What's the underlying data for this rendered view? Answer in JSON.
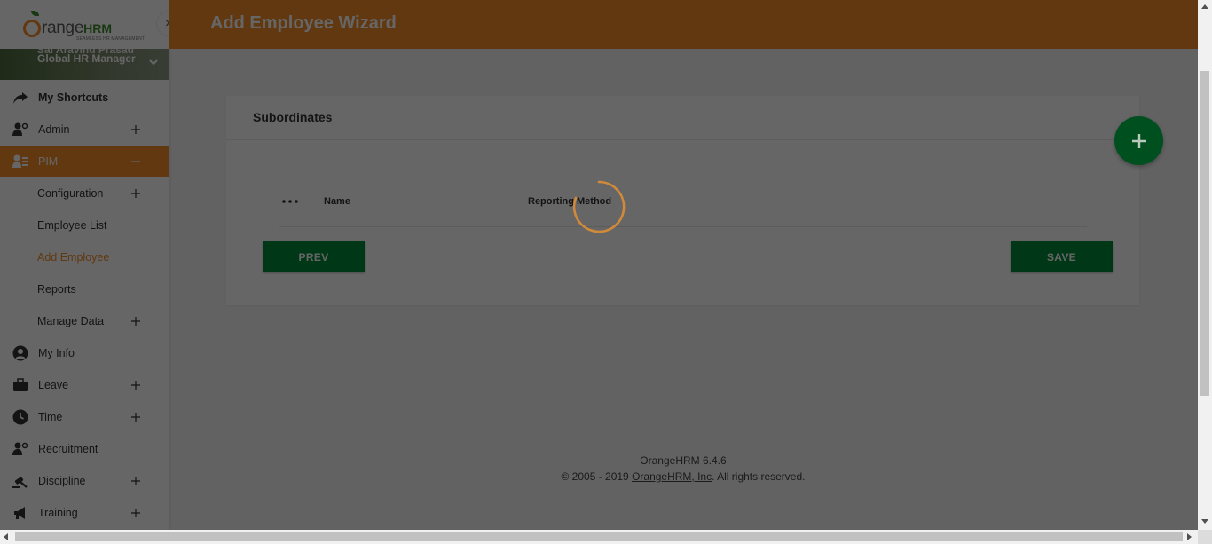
{
  "header": {
    "title": "Add Employee Wizard"
  },
  "logo": {
    "text": "range",
    "hrm": "HRM",
    "tagline": "SEAMLESS HR MANAGEMENT"
  },
  "user": {
    "name_partial": "Sai Aravind Prasad",
    "role": "Global HR Manager"
  },
  "sidebar": {
    "items": [
      {
        "label": "My Shortcuts",
        "icon": "share-arrow-icon"
      },
      {
        "label": "Admin",
        "icon": "user-gear-icon",
        "expandable": true
      },
      {
        "label": "PIM",
        "icon": "id-card-icon",
        "expanded": true,
        "active": true
      },
      {
        "label": "Configuration",
        "sub": true,
        "expandable": true
      },
      {
        "label": "Employee List",
        "sub": true
      },
      {
        "label": "Add Employee",
        "sub": true,
        "current": true
      },
      {
        "label": "Reports",
        "sub": true
      },
      {
        "label": "Manage Data",
        "sub": true,
        "expandable": true
      },
      {
        "label": "My Info",
        "icon": "user-circle-icon"
      },
      {
        "label": "Leave",
        "icon": "briefcase-icon",
        "expandable": true
      },
      {
        "label": "Time",
        "icon": "clock-icon",
        "expandable": true
      },
      {
        "label": "Recruitment",
        "icon": "user-gear-icon"
      },
      {
        "label": "Discipline",
        "icon": "gavel-icon",
        "expandable": true
      },
      {
        "label": "Training",
        "icon": "megaphone-icon",
        "expandable": true
      }
    ],
    "close_glyph": "×",
    "collapse_glyph": "−",
    "expand_glyph": "+"
  },
  "card": {
    "title": "Subordinates",
    "columns": {
      "name": "Name",
      "method": "Reporting Method"
    },
    "prev_label": "PREV",
    "save_label": "SAVE"
  },
  "footer": {
    "version": "OrangeHRM 6.4.6",
    "copy_prefix": "© 2005 - 2019 ",
    "copy_link": "OrangeHRM, Inc",
    "copy_suffix": ". All rights reserved."
  },
  "colors": {
    "brand_orange": "#f28c28",
    "brand_green": "#008b39"
  }
}
